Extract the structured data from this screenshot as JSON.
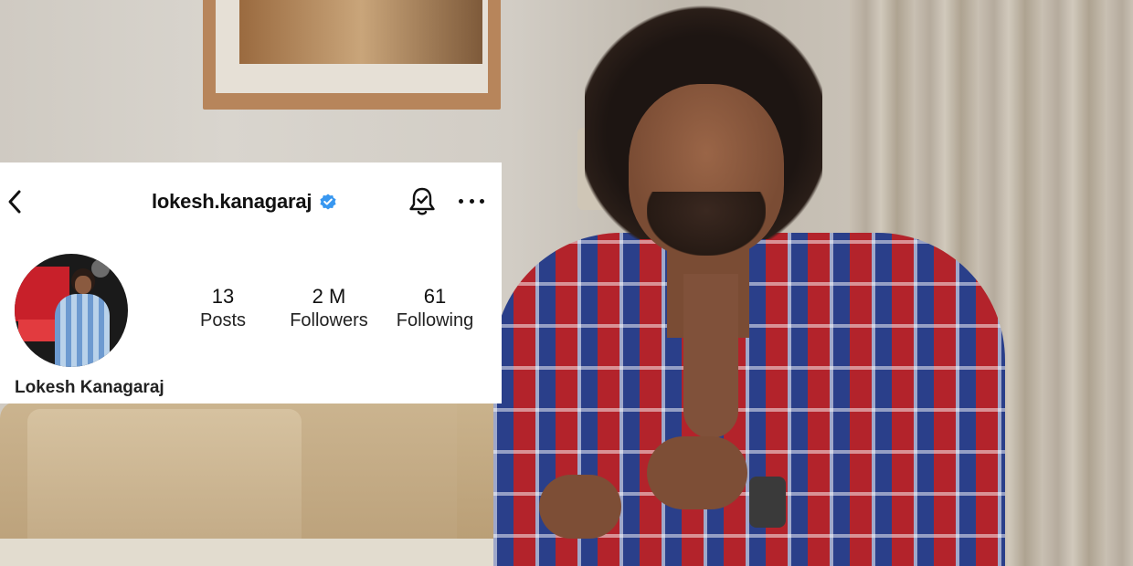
{
  "profile": {
    "username": "lokesh.kanagaraj",
    "full_name": "Lokesh Kanagaraj",
    "verified": true,
    "stats": {
      "posts": {
        "value": "13",
        "label": "Posts"
      },
      "followers": {
        "value": "2 M",
        "label": "Followers"
      },
      "following": {
        "value": "61",
        "label": "Following"
      }
    }
  },
  "icons": {
    "back": "chevron-left-icon",
    "verified": "verified-badge-icon",
    "notifications": "bell-check-icon",
    "more": "more-horizontal-icon"
  },
  "colors": {
    "verified_badge": "#3897f0",
    "card_background": "#ffffff",
    "text": "#111111"
  }
}
